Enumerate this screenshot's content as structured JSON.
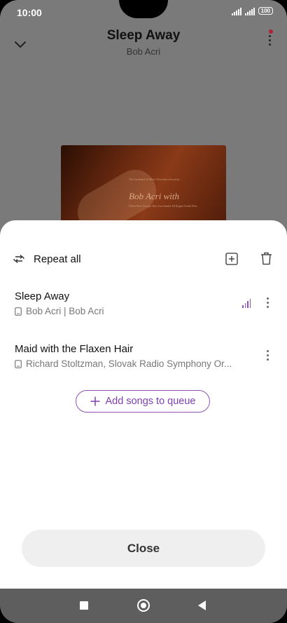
{
  "status_bar": {
    "time": "10:00",
    "battery": "100"
  },
  "player": {
    "title": "Sleep Away",
    "artist": "Bob Acri"
  },
  "album": {
    "line1": "The Landmark of Music Downtown Acoustic",
    "line2": "Bob Acri with",
    "line3": "Hulett Bass Georgie Rest Lisa Sander Ed Rogers Frank Wess"
  },
  "queue": {
    "repeat_label": "Repeat all",
    "items": [
      {
        "title": "Sleep Away",
        "subtitle": "Bob Acri | Bob Acri",
        "playing": true
      },
      {
        "title": "Maid with the Flaxen Hair",
        "subtitle": "Richard Stoltzman, Slovak Radio Symphony Or...",
        "playing": false
      }
    ],
    "add_songs_label": "Add songs to queue",
    "close_label": "Close"
  },
  "colors": {
    "accent": "#8e53b8",
    "sheet_bg": "#ffffff",
    "dim_overlay": "#7a7a7a"
  },
  "icons": [
    "chevron-down-icon",
    "more-vertical-icon",
    "repeat-icon",
    "add-to-playlist-icon",
    "trash-icon",
    "device-icon",
    "equalizer-icon",
    "plus-icon"
  ]
}
